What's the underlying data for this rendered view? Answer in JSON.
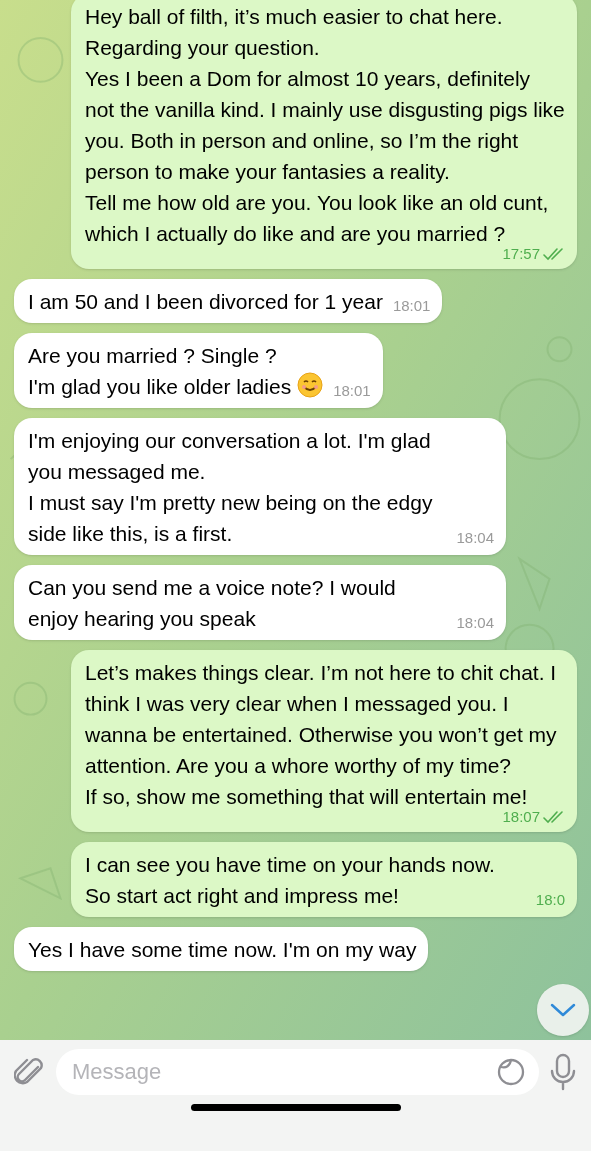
{
  "messages": [
    {
      "kind": "out",
      "text": "Hey ball of filth, it’s much easier to chat here.\nRegarding your question.\nYes I been a Dom for almost 10 years, definitely not the vanilla kind. I mainly use disgusting pigs like you. Both in person and online, so I’m the right person to make your fantasies a reality.\nTell me how old are you. You look like an old cunt, which I actually do like and are you married ?",
      "time": "17:57",
      "read": true
    },
    {
      "kind": "in",
      "text": "I am 50 and I been divorced for 1 year",
      "time": "18:01"
    },
    {
      "kind": "in",
      "text": "Are you married ? Single ?\nI'm glad you like older ladies",
      "smiley": true,
      "time": "18:01"
    },
    {
      "kind": "in",
      "text": "I'm enjoying our conversation a lot. I'm glad you messaged me.\nI must say I'm pretty new being on the edgy side like this, is a first.",
      "time": "18:04"
    },
    {
      "kind": "in",
      "text": "Can you send me a voice note? I would enjoy hearing you speak",
      "time": "18:04"
    },
    {
      "kind": "out",
      "text": "Let’s makes things clear. I’m not here to chit chat. I think I was very clear when I messaged you. I wanna be entertained. Otherwise you won’t get my attention. Are you a whore worthy of my time?\nIf so, show me something that will entertain me!",
      "time": "18:07",
      "read": true
    },
    {
      "kind": "out",
      "text": "I can see you have time on your hands now. So start act right and impress me!",
      "time": "18:0"
    },
    {
      "kind": "in",
      "text": "Yes I have some time now. I'm on my way"
    }
  ],
  "composer": {
    "placeholder": "Message"
  }
}
